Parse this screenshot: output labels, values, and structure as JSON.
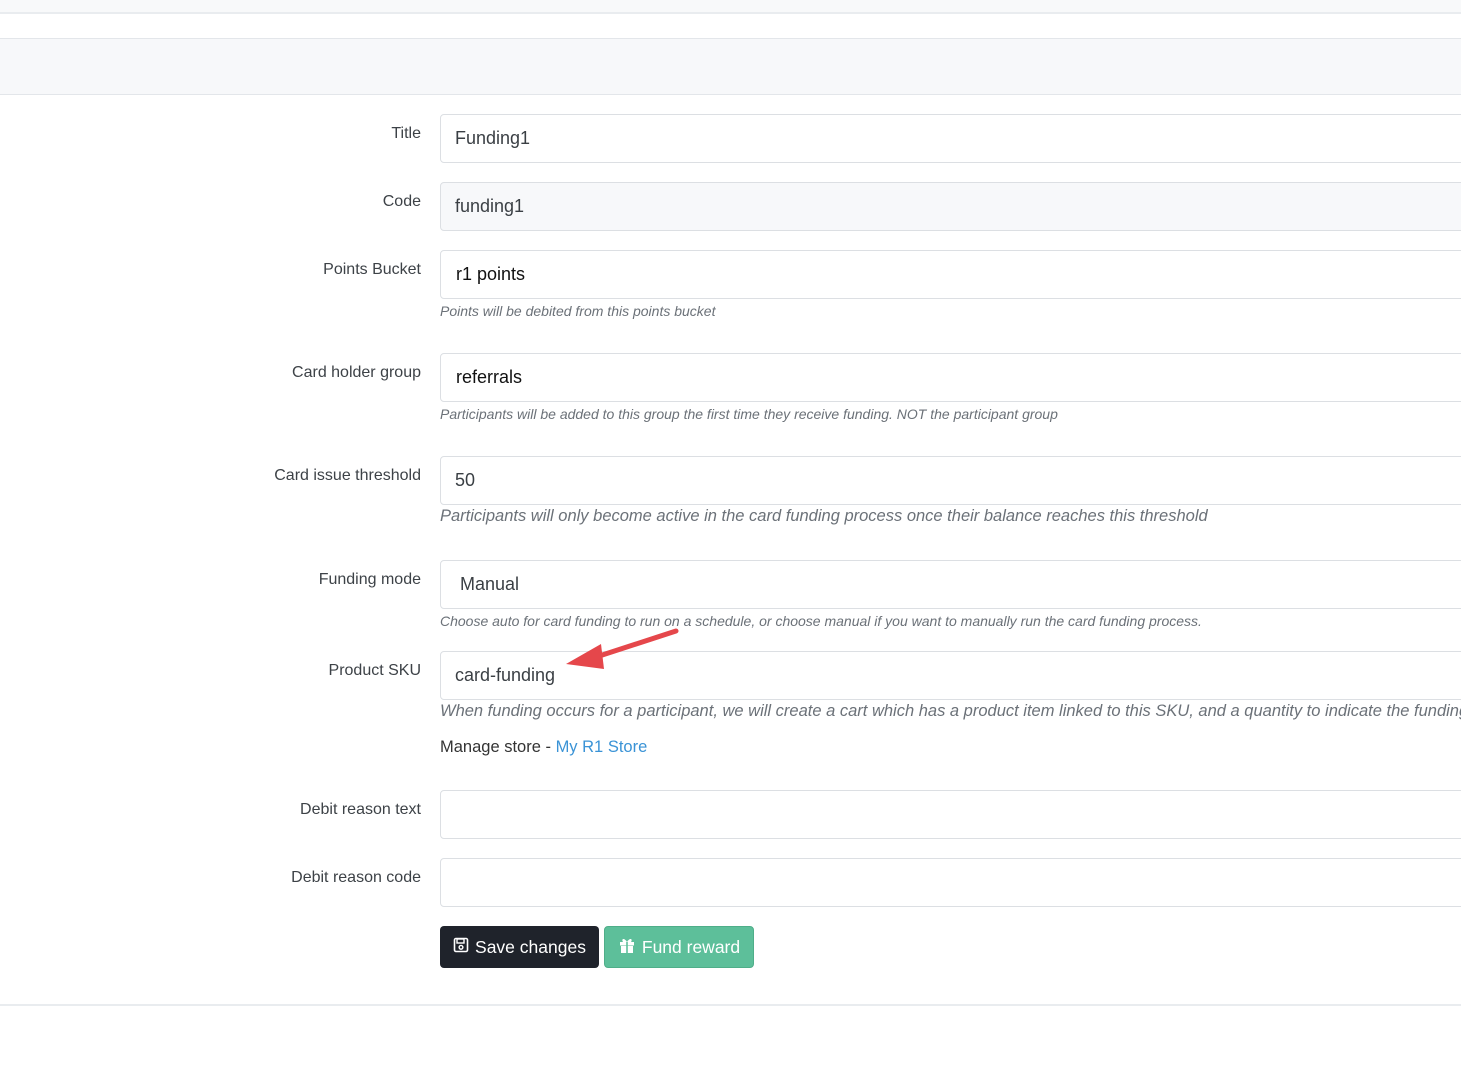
{
  "form": {
    "title": {
      "label": "Title",
      "value": "Funding1"
    },
    "code": {
      "label": "Code",
      "value": "funding1"
    },
    "points_bucket": {
      "label": "Points Bucket",
      "value": "r1 points",
      "help": "Points will be debited from this points bucket"
    },
    "card_holder_group": {
      "label": "Card holder group",
      "value": "referrals",
      "help": "Participants will be added to this group the first time they receive funding. NOT the participant group"
    },
    "card_issue_threshold": {
      "label": "Card issue threshold",
      "value": "50",
      "help": "Participants will only become active in the card funding process once their balance reaches this threshold"
    },
    "funding_mode": {
      "label": "Funding mode",
      "value": "Manual",
      "help": "Choose auto for card funding to run on a schedule, or choose manual if you want to manually run the card funding process."
    },
    "product_sku": {
      "label": "Product SKU",
      "value": "card-funding",
      "help": "When funding occurs for a participant, we will create a cart which has a product item linked to this SKU, and a quantity to indicate the funding a"
    },
    "manage_store": {
      "prefix": "Manage store - ",
      "link": "My R1 Store"
    },
    "debit_reason_text": {
      "label": "Debit reason text",
      "value": ""
    },
    "debit_reason_code": {
      "label": "Debit reason code",
      "value": ""
    }
  },
  "actions": {
    "save_label": "Save changes",
    "fund_label": "Fund reward"
  },
  "icons": {
    "save": "floppy-disk-icon",
    "fund": "gift-icon",
    "annotation": "red-arrow"
  },
  "colors": {
    "save_button": "#1f232b",
    "fund_button": "#5dbf9a",
    "link": "#3a93d6",
    "annotation_arrow": "#e5474b"
  }
}
